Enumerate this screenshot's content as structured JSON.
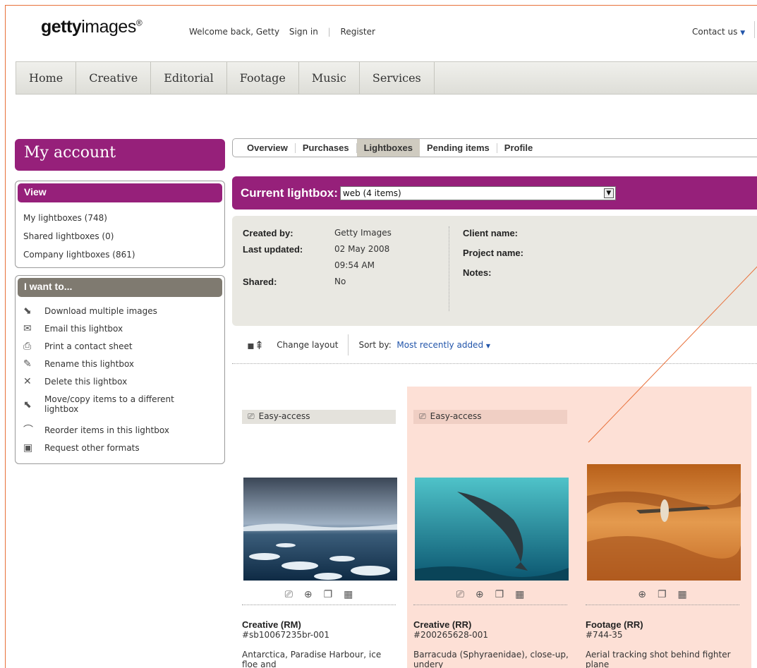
{
  "header": {
    "logo_bold": "getty",
    "logo_rest": "images",
    "logo_mark": "®",
    "welcome": "Welcome back, Getty",
    "sign_in": "Sign in",
    "register": "Register",
    "contact": "Contact us"
  },
  "main_nav": [
    "Home",
    "Creative",
    "Editorial",
    "Footage",
    "Music",
    "Services"
  ],
  "account_title": "My account",
  "view": {
    "title": "View",
    "links": [
      "My lightboxes (748)",
      "Shared lightboxes (0)",
      "Company lightboxes (861)"
    ]
  },
  "want": {
    "title": "I want to...",
    "items": [
      {
        "label": "Download multiple images",
        "icon": "download-icon"
      },
      {
        "label": "Email this lightbox",
        "icon": "email-icon"
      },
      {
        "label": "Print a contact sheet",
        "icon": "print-icon"
      },
      {
        "label": "Rename this lightbox",
        "icon": "pencil-icon"
      },
      {
        "label": "Delete this lightbox",
        "icon": "delete-icon"
      },
      {
        "label": "Move/copy items to a different lightbox",
        "icon": "move-icon"
      },
      {
        "label": "Reorder items in this lightbox",
        "icon": "reorder-icon"
      },
      {
        "label": "Request other formats",
        "icon": "formats-icon"
      }
    ]
  },
  "subnav": [
    "Overview",
    "Purchases",
    "Lightboxes",
    "Pending items",
    "Profile"
  ],
  "subnav_active": "Lightboxes",
  "lightbox": {
    "label": "Current lightbox:",
    "selected": "web (4 items)"
  },
  "info": {
    "created_by_label": "Created by:",
    "created_by": "Getty Images",
    "last_updated_label": "Last updated:",
    "last_updated_date": "02 May 2008",
    "last_updated_time": "09:54 AM",
    "shared_label": "Shared:",
    "shared": "No",
    "client_label": "Client name:",
    "project_label": "Project name:",
    "notes_label": "Notes:"
  },
  "tools": {
    "change_layout": "Change layout",
    "sort_label": "Sort by:",
    "sort_value": "Most recently added"
  },
  "items": [
    {
      "easy": "Easy-access",
      "title": "Creative (RM)",
      "id": "#sb10067235br-001",
      "desc": "Antarctica, Paradise Harbour, ice floe and",
      "image": "antarctica-photo"
    },
    {
      "easy": "Easy-access",
      "title": "Creative (RR)",
      "id": "#200265628-001",
      "desc": "Barracuda (Sphyraenidae), close-up, undery",
      "image": "barracuda-photo"
    },
    {
      "easy": "",
      "title": "Footage  (RR)",
      "id": "#744-35",
      "desc": "Aerial tracking shot behind fighter plane",
      "image": "desert-plane-photo"
    }
  ],
  "colors": {
    "brand": "#96207a",
    "highlight": "#fde0d6",
    "accent_line": "#e8703a"
  }
}
